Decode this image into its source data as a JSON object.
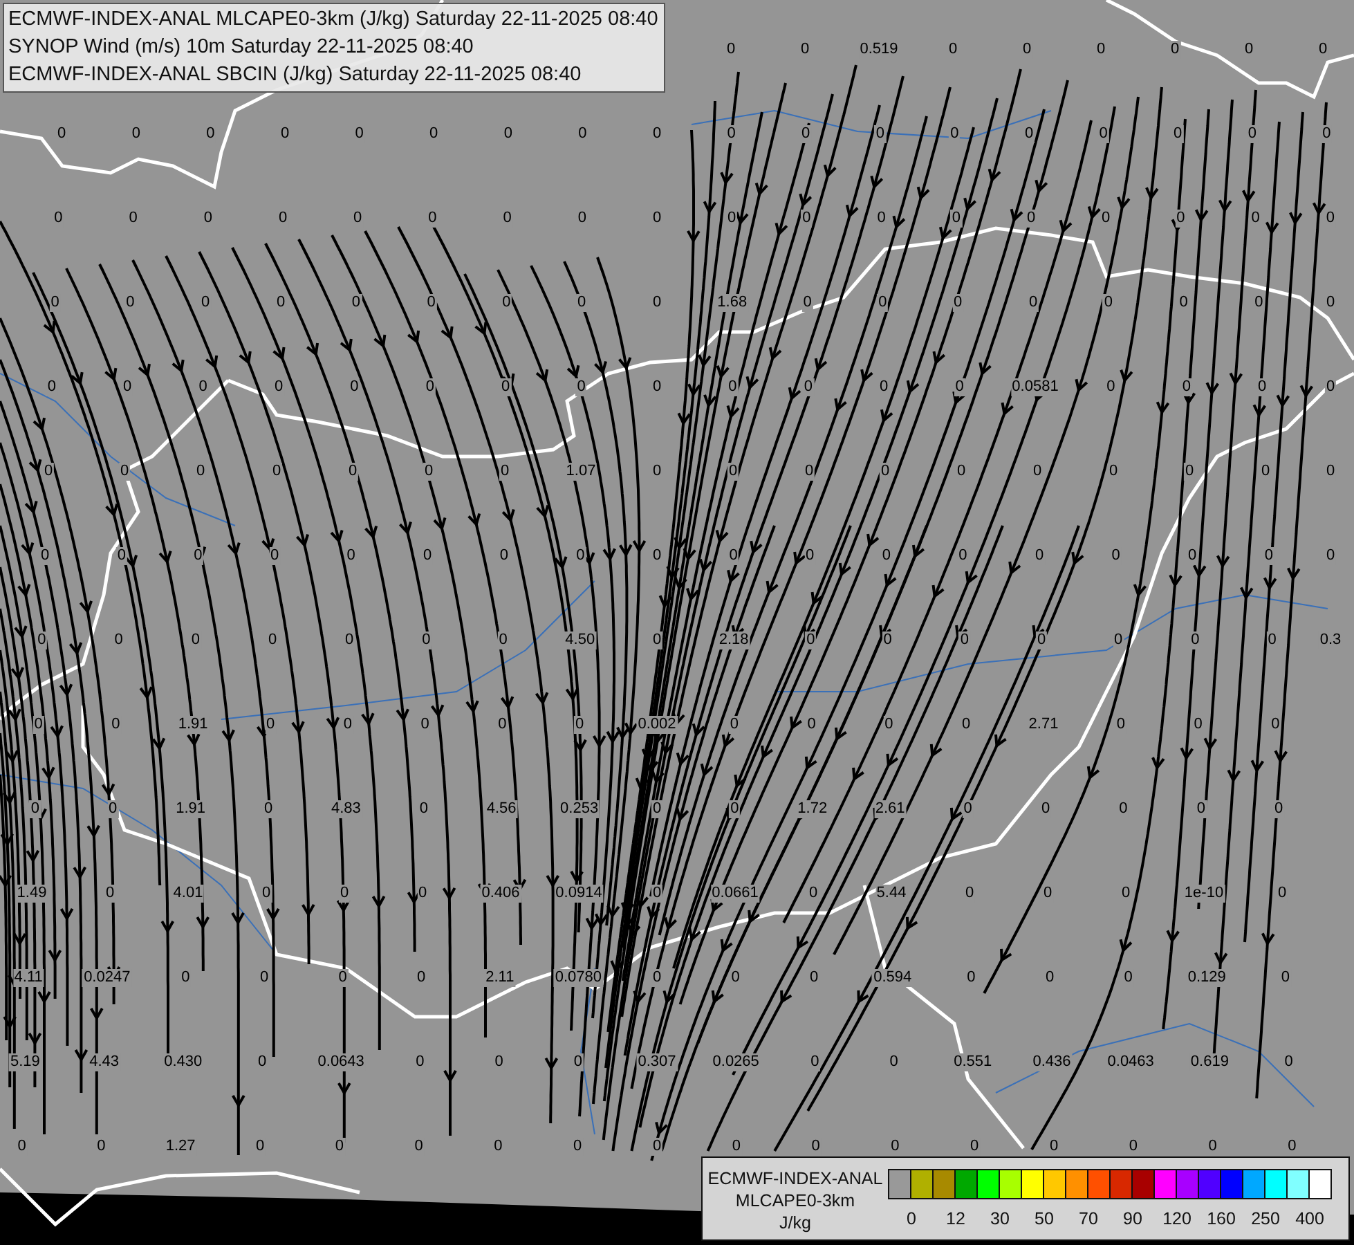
{
  "header": {
    "lines": [
      "ECMWF-INDEX-ANAL MLCAPE0-3km (J/kg) Saturday 22-11-2025 08:40",
      "SYNOP Wind (m/s) 10m Saturday 22-11-2025 08:40",
      "ECMWF-INDEX-ANAL SBCIN (J/kg) Saturday 22-11-2025 08:40"
    ]
  },
  "map": {
    "value_rows": [
      [
        null,
        null,
        null,
        null,
        null,
        null,
        null,
        null,
        null,
        "0",
        "0",
        "0.519",
        "0",
        "0",
        "0",
        "0",
        "0",
        "0"
      ],
      [
        "0",
        "0",
        "0",
        "0",
        "0",
        "0",
        "0",
        "0",
        "0",
        "0",
        "0",
        "0",
        "0",
        "0",
        "0",
        "0",
        "0",
        "0"
      ],
      [
        "0",
        "0",
        "0",
        "0",
        "0",
        "0",
        "0",
        "0",
        "0",
        "0",
        "0",
        "0",
        "0",
        "0",
        "0",
        "0",
        "0",
        "0"
      ],
      [
        "0",
        "0",
        "0",
        "0",
        "0",
        "0",
        "0",
        "0",
        "0",
        "1.68",
        "0",
        "0",
        "0",
        "0",
        "0",
        "0",
        "0",
        "0"
      ],
      [
        "0",
        "0",
        "0",
        "0",
        "0",
        "0",
        "0",
        "0",
        "0",
        "0",
        "0",
        "0",
        "0",
        "0.0581",
        "0",
        "0",
        "0",
        "0"
      ],
      [
        "0",
        "0",
        "0",
        "0",
        "0",
        "0",
        "0",
        "1.07",
        "0",
        "0",
        "0",
        "0",
        "0",
        "0",
        "0",
        "0",
        "0",
        "0"
      ],
      [
        "0",
        "0",
        "0",
        "0",
        "0",
        "0",
        "0",
        "0",
        "0",
        "0",
        "0",
        "0",
        "0",
        "0",
        "0",
        "0",
        "0",
        "0"
      ],
      [
        "0",
        "0",
        "0",
        "0",
        "0",
        "0",
        "0",
        "4.50",
        "0",
        "2.18",
        "0",
        "0",
        "0",
        "0",
        "0",
        "0",
        "0",
        "0.3"
      ],
      [
        "0",
        "0",
        "1.91",
        "0",
        "0",
        "0",
        "0",
        "0",
        "0.002",
        "0",
        "0",
        "0",
        "0",
        "2.71",
        "0",
        "0",
        "0",
        null
      ],
      [
        "0",
        "0",
        "1.91",
        "0",
        "4.83",
        "0",
        "4.56",
        "0.253",
        "0",
        "0",
        "1.72",
        "2.61",
        "0",
        "0",
        "0",
        "0",
        "0",
        null
      ],
      [
        "1.49",
        "0",
        "4.01",
        "0",
        "0",
        "0",
        "0.406",
        "0.0914",
        "0",
        "0.0661",
        "0",
        "5.44",
        "0",
        "0",
        "0",
        "1e-10",
        "0",
        null
      ],
      [
        "4.11",
        "0.0247",
        "0",
        "0",
        "0",
        "0",
        "2.11",
        "0.0780",
        "0",
        "0",
        "0",
        "0.594",
        "0",
        "0",
        "0",
        "0.129",
        "0",
        null
      ],
      [
        "5.19",
        "4.43",
        "0.430",
        "0",
        "0.0643",
        "0",
        "0",
        "0",
        "0.307",
        "0.0265",
        "0",
        "0",
        "0.551",
        "0.436",
        "0.0463",
        "0.619",
        "0",
        null
      ],
      [
        "0",
        "0",
        "1.27",
        "0",
        "0",
        "0",
        "0",
        "0",
        "0",
        "0",
        "0",
        "0",
        "0",
        "0",
        "0",
        "0",
        "0",
        null
      ]
    ]
  },
  "legend": {
    "title": "ECMWF-INDEX-ANAL",
    "subtitle": "MLCAPE0-3km",
    "unit": "J/kg",
    "swatches": [
      {
        "color": "#999999"
      },
      {
        "color": "#b0b000"
      },
      {
        "color": "#a88a00"
      },
      {
        "color": "#00a800"
      },
      {
        "color": "#00ff00"
      },
      {
        "color": "#a8ff00"
      },
      {
        "color": "#ffff00"
      },
      {
        "color": "#ffc800"
      },
      {
        "color": "#ff9000"
      },
      {
        "color": "#ff5000"
      },
      {
        "color": "#d82800"
      },
      {
        "color": "#a80000"
      },
      {
        "color": "#ff00ff"
      },
      {
        "color": "#a800ff"
      },
      {
        "color": "#5000ff"
      },
      {
        "color": "#0000ff"
      },
      {
        "color": "#00a8ff"
      },
      {
        "color": "#00ffff"
      },
      {
        "color": "#80ffff"
      },
      {
        "color": "#ffffff"
      }
    ],
    "ticks": [
      "0",
      "12",
      "30",
      "50",
      "70",
      "90",
      "120",
      "160",
      "250",
      "400"
    ]
  }
}
